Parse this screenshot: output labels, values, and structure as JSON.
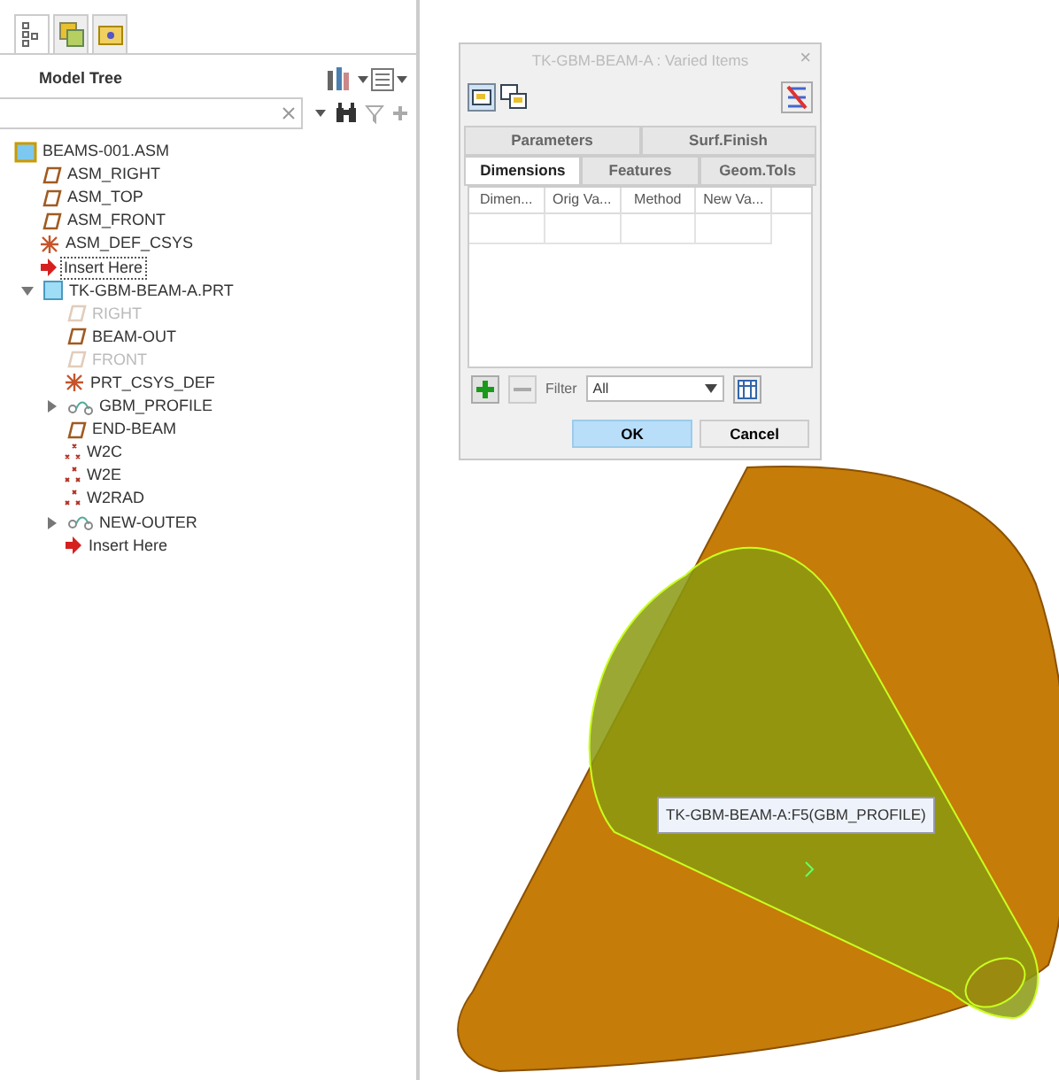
{
  "panel_tabs": [
    {
      "kind": "tree",
      "selected": true
    },
    {
      "kind": "layers",
      "selected": false
    },
    {
      "kind": "folder",
      "selected": false
    }
  ],
  "model_tree": {
    "title": "Model Tree",
    "items": [
      {
        "label": "BEAMS-001.ASM",
        "kind": "asm",
        "disabled": false,
        "selected": false,
        "children": [
          {
            "label": "ASM_RIGHT",
            "kind": "plane",
            "disabled": false,
            "selected": false
          },
          {
            "label": "ASM_TOP",
            "kind": "plane",
            "disabled": false,
            "selected": false
          },
          {
            "label": "ASM_FRONT",
            "kind": "plane",
            "disabled": false,
            "selected": false
          },
          {
            "label": "ASM_DEF_CSYS",
            "kind": "csys",
            "disabled": false,
            "selected": false
          },
          {
            "label": "Insert Here",
            "kind": "insert",
            "disabled": false,
            "selected": true
          },
          {
            "label": "TK-GBM-BEAM-A.PRT",
            "kind": "part",
            "disabled": false,
            "selected": false,
            "expanded": true,
            "children": [
              {
                "label": "RIGHT",
                "kind": "plane",
                "disabled": true,
                "selected": false
              },
              {
                "label": "BEAM-OUT",
                "kind": "plane",
                "disabled": false,
                "selected": false
              },
              {
                "label": "FRONT",
                "kind": "plane",
                "disabled": true,
                "selected": false
              },
              {
                "label": "PRT_CSYS_DEF",
                "kind": "csys",
                "disabled": false,
                "selected": false
              },
              {
                "label": "GBM_PROFILE",
                "kind": "sketch",
                "disabled": false,
                "selected": false,
                "expanded": false
              },
              {
                "label": "END-BEAM",
                "kind": "plane",
                "disabled": false,
                "selected": false
              },
              {
                "label": "W2C",
                "kind": "point",
                "disabled": false,
                "selected": false
              },
              {
                "label": "W2E",
                "kind": "point",
                "disabled": false,
                "selected": false
              },
              {
                "label": "W2RAD",
                "kind": "point",
                "disabled": false,
                "selected": false
              },
              {
                "label": "NEW-OUTER",
                "kind": "sketch",
                "disabled": false,
                "selected": false,
                "expanded": false
              },
              {
                "label": "Insert Here",
                "kind": "insert",
                "disabled": false,
                "selected": false
              }
            ]
          }
        ]
      }
    ]
  },
  "dialog": {
    "title": "TK-GBM-BEAM-A : Varied Items",
    "close": "×",
    "tab_rows": [
      [
        {
          "label": "Parameters",
          "selected": false
        },
        {
          "label": "Surf.Finish",
          "selected": false
        }
      ],
      [
        {
          "label": "Dimensions",
          "selected": true
        },
        {
          "label": "Features",
          "selected": false
        },
        {
          "label": "Geom.Tols",
          "selected": false
        }
      ]
    ],
    "columns": [
      "Dimen...",
      "Orig Va...",
      "Method",
      "New Va..."
    ],
    "filter_label": "Filter",
    "filter_value": "All",
    "buttons": [
      "OK",
      "Cancel"
    ]
  },
  "tooltip": "TK-GBM-BEAM-A:F5(GBM_PROFILE)"
}
